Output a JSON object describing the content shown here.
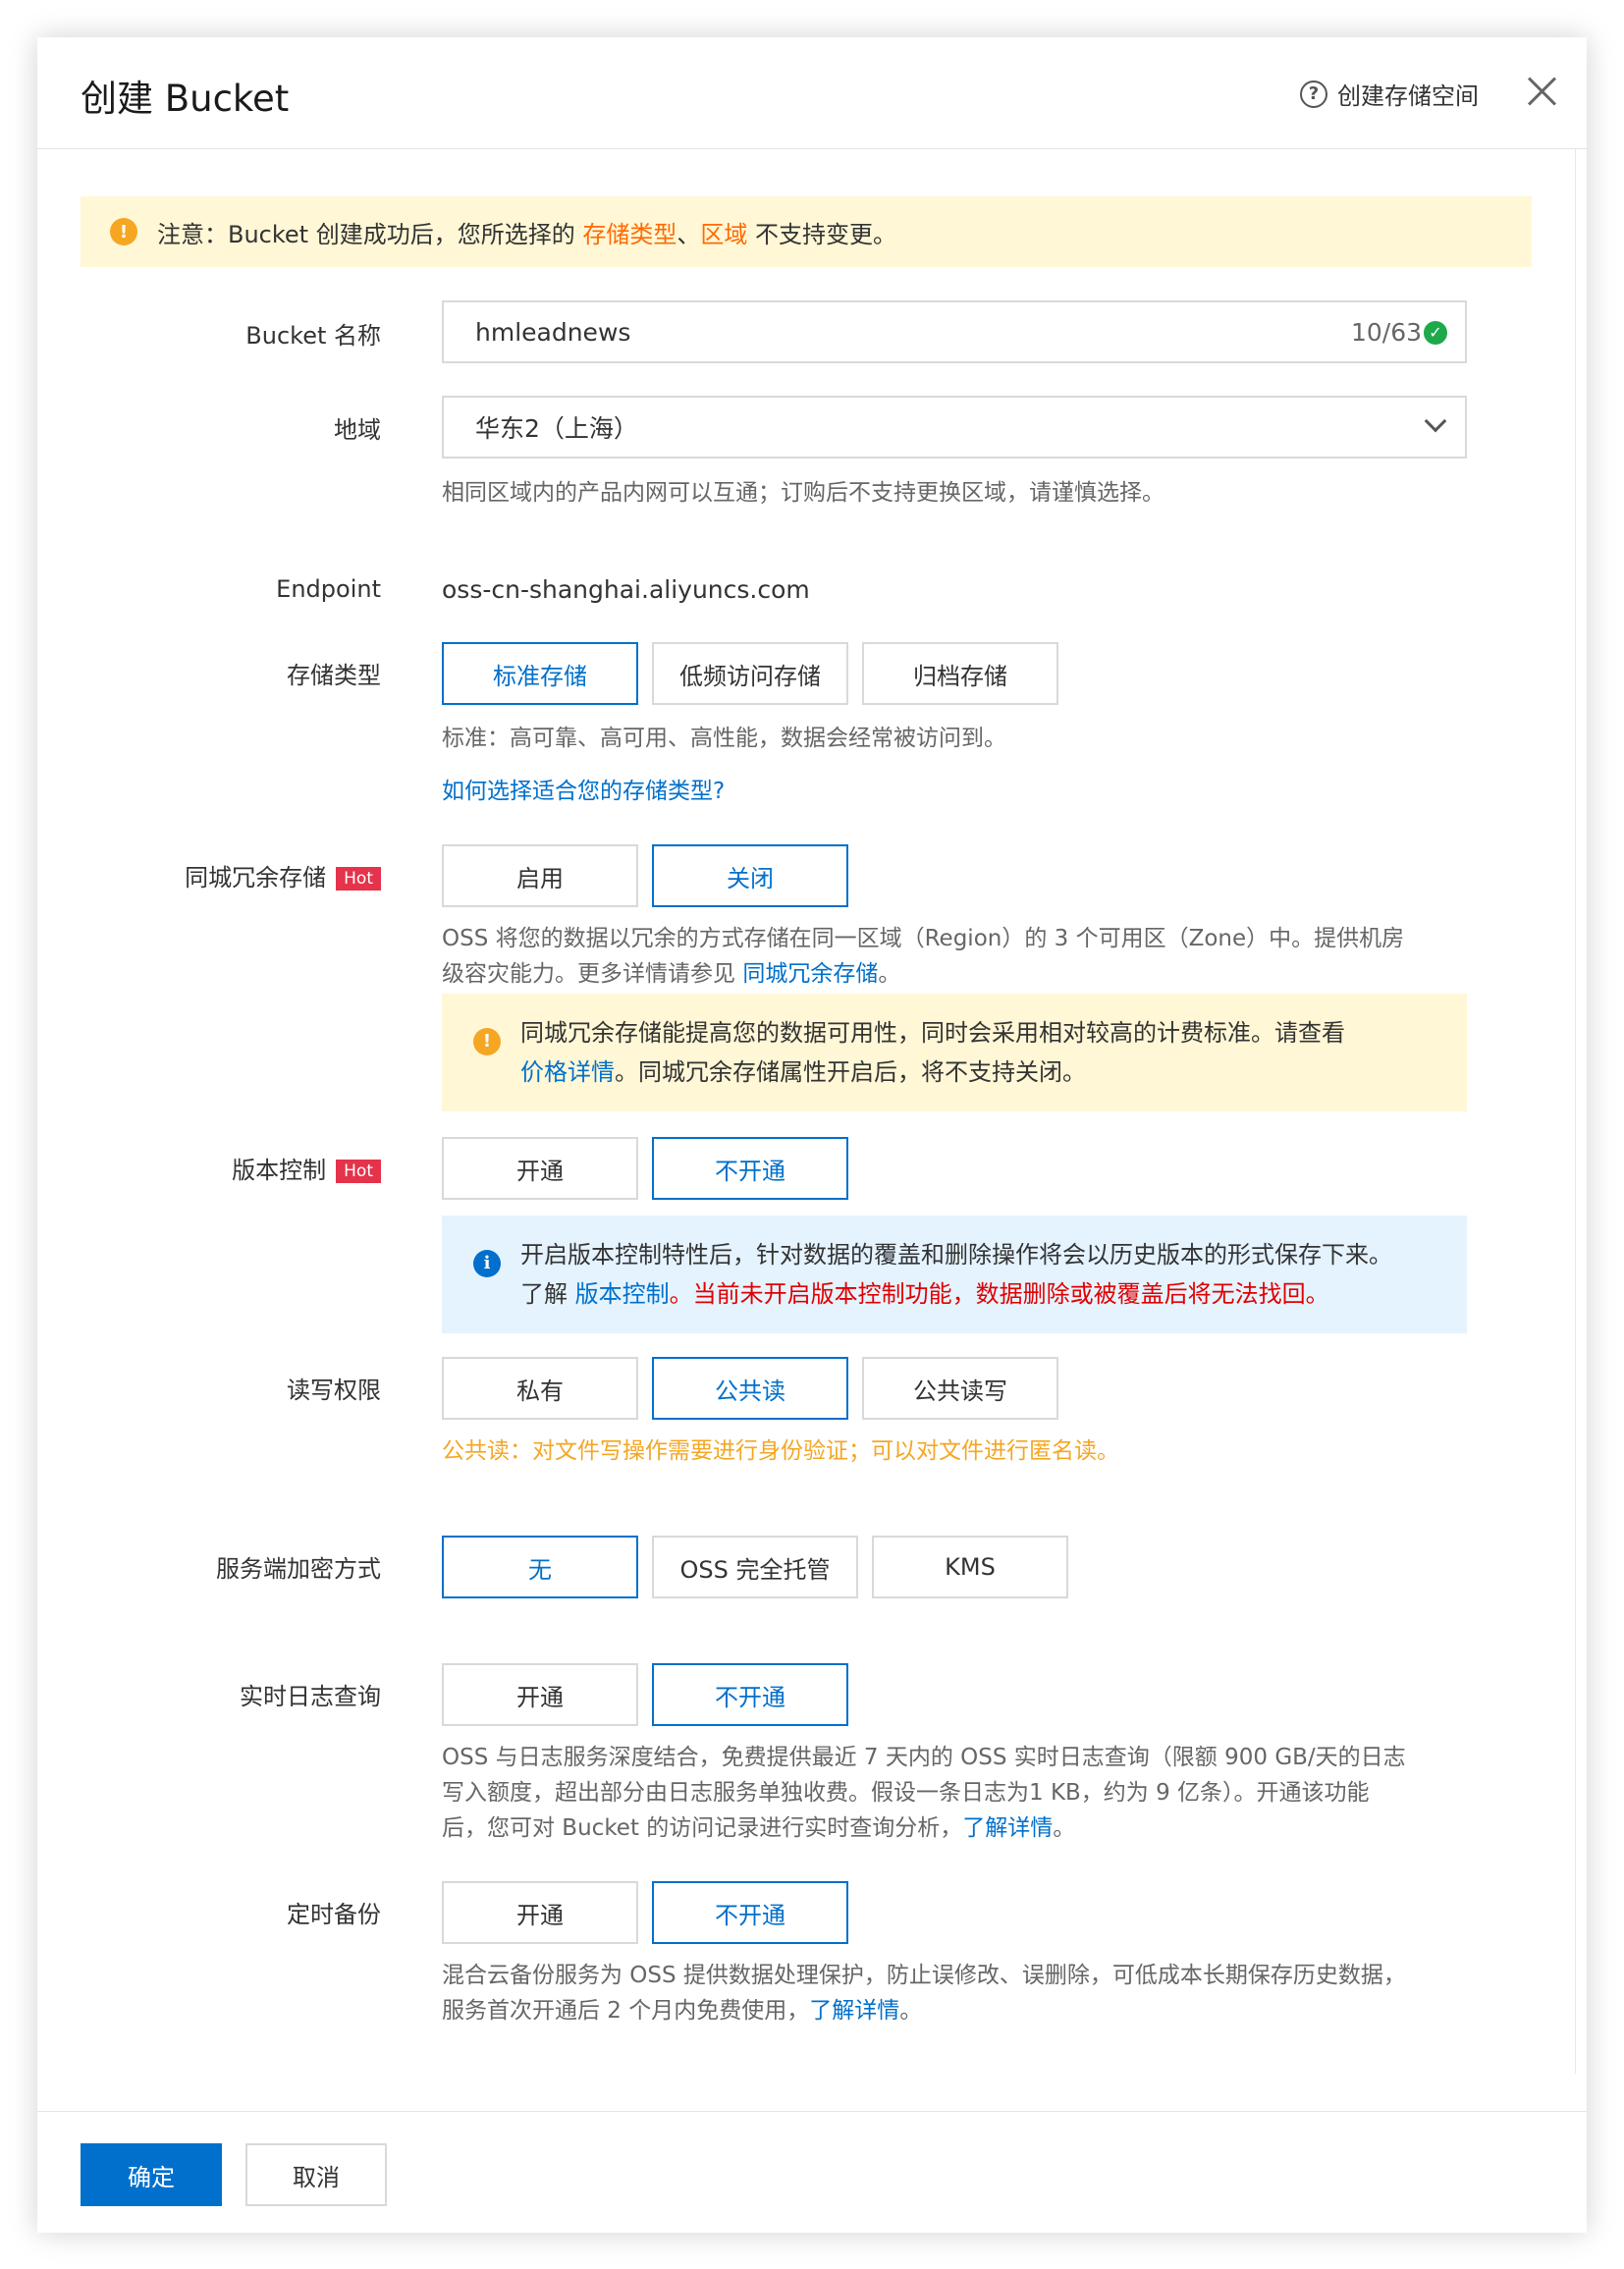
{
  "dialog": {
    "title": "创建 Bucket",
    "help_link": "创建存储空间"
  },
  "notice": {
    "prefix": "注意：Bucket 创建成功后，您所选择的 ",
    "highlight1": "存储类型",
    "sep": "、",
    "highlight2": "区域",
    "suffix": " 不支持变更。"
  },
  "bucket_name": {
    "label": "Bucket 名称",
    "value": "hmleadnews",
    "counter": "10/63"
  },
  "region": {
    "label": "地域",
    "value": "华东2（上海）",
    "help": "相同区域内的产品内网可以互通；订购后不支持更换区域，请谨慎选择。"
  },
  "endpoint": {
    "label": "Endpoint",
    "value": "oss-cn-shanghai.aliyuncs.com"
  },
  "storage_class": {
    "label": "存储类型",
    "options": [
      "标准存储",
      "低频访问存储",
      "归档存储"
    ],
    "selected": "标准存储",
    "help": "标准：高可靠、高可用、高性能，数据会经常被访问到。",
    "link": "如何选择适合您的存储类型?"
  },
  "zrs": {
    "label": "同城冗余存储",
    "badge": "Hot",
    "options": [
      "启用",
      "关闭"
    ],
    "selected": "关闭",
    "help_line1": "OSS 将您的数据以冗余的方式存储在同一区域（Region）的 3 个可用区（Zone）中。提供机房",
    "help_line2_prefix": "级容灾能力。更多详情请参见 ",
    "help_link": "同城冗余存储",
    "help_line2_suffix": "。",
    "alert_line1": "同城冗余存储能提高您的数据可用性，同时会采用相对较高的计费标准。请查看",
    "alert_link": "价格详情",
    "alert_line2_suffix": "。同城冗余存储属性开启后，将不支持关闭。"
  },
  "versioning": {
    "label": "版本控制",
    "badge": "Hot",
    "options": [
      "开通",
      "不开通"
    ],
    "selected": "不开通",
    "alert_line1": "开启版本控制特性后，针对数据的覆盖和删除操作将会以历史版本的形式保存下来。",
    "alert_line2_prefix": "了解 ",
    "alert_link": "版本控制",
    "alert_line2_warning": "。当前未开启版本控制功能，数据删除或被覆盖后将无法找回。"
  },
  "acl": {
    "label": "读写权限",
    "options": [
      "私有",
      "公共读",
      "公共读写"
    ],
    "selected": "公共读",
    "warning": "公共读：对文件写操作需要进行身份验证；可以对文件进行匿名读。"
  },
  "encryption": {
    "label": "服务端加密方式",
    "options": [
      "无",
      "OSS 完全托管",
      "KMS"
    ],
    "selected": "无"
  },
  "realtime_log": {
    "label": "实时日志查询",
    "options": [
      "开通",
      "不开通"
    ],
    "selected": "不开通",
    "help_line1": "OSS 与日志服务深度结合，免费提供最近 7 天内的 OSS 实时日志查询（限额 900 GB/天的日志",
    "help_line2": "写入额度，超出部分由日志服务单独收费。假设一条日志为1 KB，约为 9 亿条）。开通该功能",
    "help_line3_prefix": "后，您可对 Bucket 的访问记录进行实时查询分析，",
    "help_link": "了解详情",
    "help_line3_suffix": "。"
  },
  "backup": {
    "label": "定时备份",
    "options": [
      "开通",
      "不开通"
    ],
    "selected": "不开通",
    "help_line1": "混合云备份服务为 OSS 提供数据处理保护，防止误修改、误删除，可低成本长期保存历史数据，",
    "help_line2_prefix": "服务首次开通后 2 个月内免费使用，",
    "help_link": "了解详情",
    "help_line2_suffix": "。"
  },
  "footer": {
    "confirm": "确定",
    "cancel": "取消"
  },
  "colors": {
    "primary": "#0070cc",
    "warning_bg": "#fff7d6",
    "info_bg": "#e5f3ff",
    "hot_badge": "#e5334b",
    "accent_orange": "#ff6a00",
    "danger": "#e00000",
    "amber_text": "#f5a623"
  },
  "icons": {
    "help": "question-circle-icon",
    "close": "close-icon",
    "warning": "exclamation-circle-icon",
    "info": "info-circle-icon",
    "check": "check-circle-icon",
    "dropdown": "chevron-down-icon"
  }
}
